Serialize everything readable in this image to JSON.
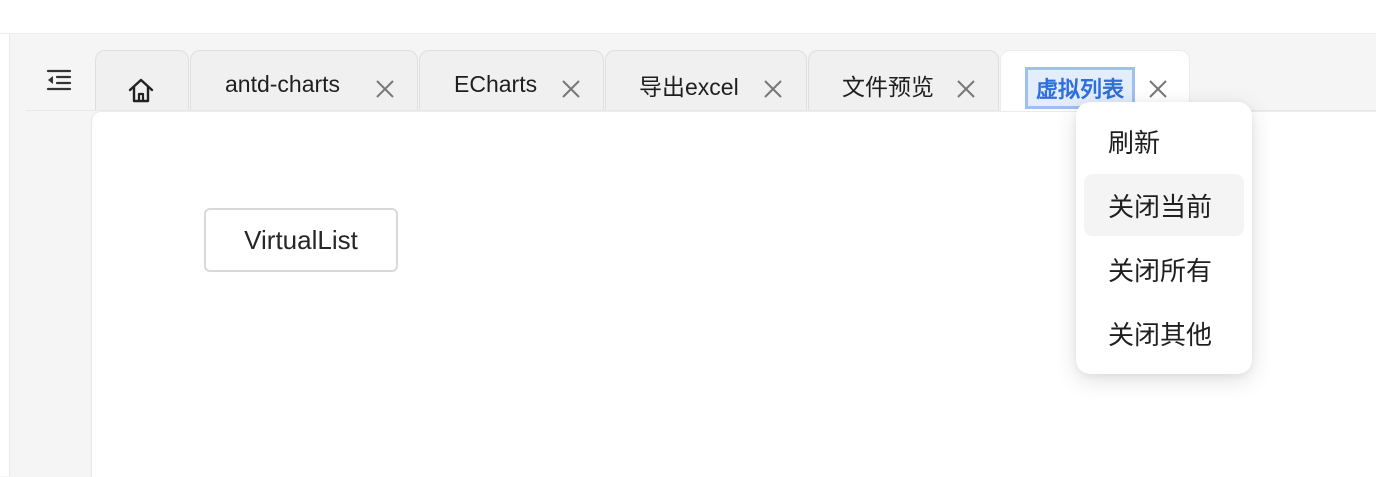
{
  "tabs": {
    "home_icon": "home-icon",
    "items": [
      {
        "label": "antd-charts",
        "close": "X"
      },
      {
        "label": "ECharts",
        "close": "X"
      },
      {
        "label": "导出excel",
        "close": "X"
      },
      {
        "label": "文件预览",
        "close": "X"
      }
    ],
    "active": {
      "label": "虚拟列表",
      "close": "X"
    }
  },
  "content": {
    "button_label": "VirtualList"
  },
  "context_menu": {
    "items": [
      "刷新",
      "关闭当前",
      "关闭所有",
      "关闭其他"
    ],
    "highlighted": "关闭当前"
  },
  "colors": {
    "accent": "#2f6fdc",
    "selection_border": "#9ec0ef",
    "selection_fill": "#e4edfb"
  }
}
